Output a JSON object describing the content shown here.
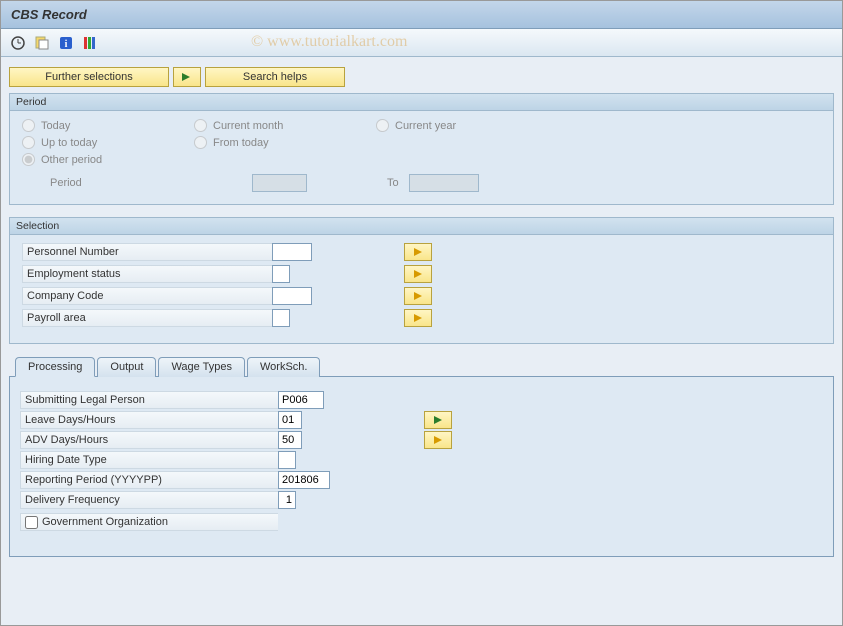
{
  "title": "CBS Record",
  "watermark": "© www.tutorialkart.com",
  "toolbar": {
    "further_selections": "Further selections",
    "search_helps": "Search helps"
  },
  "period": {
    "title": "Period",
    "today": "Today",
    "current_month": "Current month",
    "current_year": "Current year",
    "up_to_today": "Up to today",
    "from_today": "From today",
    "other_period": "Other period",
    "period_label": "Period",
    "to_label": "To",
    "period_from": "",
    "period_to": ""
  },
  "selection": {
    "title": "Selection",
    "personnel_number": {
      "label": "Personnel Number",
      "value": ""
    },
    "employment_status": {
      "label": "Employment status",
      "value": ""
    },
    "company_code": {
      "label": "Company Code",
      "value": ""
    },
    "payroll_area": {
      "label": "Payroll area",
      "value": ""
    }
  },
  "tabs": {
    "processing": "Processing",
    "output": "Output",
    "wage_types": "Wage Types",
    "worksch": "WorkSch."
  },
  "processing": {
    "submitting_legal_person": {
      "label": "Submitting Legal Person",
      "value": "P006"
    },
    "leave_days_hours": {
      "label": "Leave Days/Hours",
      "value": "01"
    },
    "adv_days_hours": {
      "label": "ADV Days/Hours",
      "value": "50"
    },
    "hiring_date_type": {
      "label": "Hiring Date Type",
      "value": ""
    },
    "reporting_period": {
      "label": "Reporting Period (YYYYPP)",
      "value": "201806"
    },
    "delivery_frequency": {
      "label": "Delivery Frequency",
      "value": "1"
    },
    "government_org": {
      "label": "Government Organization",
      "checked": false
    }
  }
}
